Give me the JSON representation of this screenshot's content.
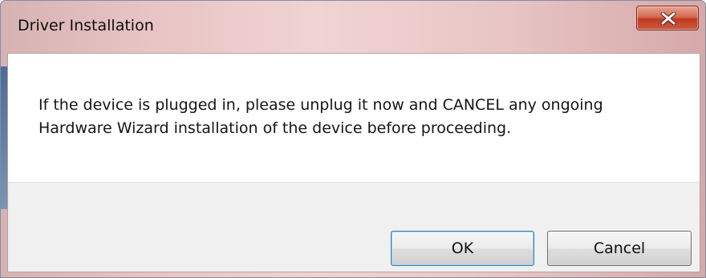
{
  "window": {
    "title": "Driver Installation"
  },
  "message": {
    "text": "If the device is plugged in, please unplug it now and CANCEL any ongoing Hardware Wizard installation of the device before proceeding."
  },
  "buttons": {
    "ok_label": "OK",
    "cancel_label": "Cancel"
  },
  "icons": {
    "close": "close-icon"
  },
  "colors": {
    "close_button": "#c2391f",
    "titlebar": "#e8c3c3",
    "default_button_focus": "#3c7fb1"
  }
}
